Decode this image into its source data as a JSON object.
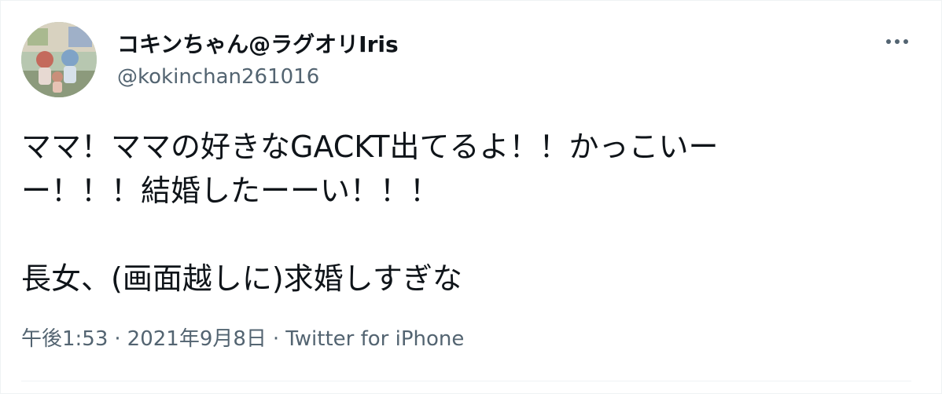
{
  "tweet": {
    "author": {
      "display_name": "コキンちゃん@ラグオリIris",
      "handle": "@kokinchan261016"
    },
    "text": "ママ！ママの好きなGACKT出てるよ！！かっこいー\nー！！！結婚したーーい！！！\n\n長女、(画面越しに)求婚しすぎな",
    "meta": {
      "time": "午後1:53",
      "separator": "·",
      "date": "2021年9月8日",
      "source": "Twitter for iPhone"
    },
    "more_icon": "more-horizontal-icon"
  },
  "colors": {
    "text_primary": "#0f1419",
    "text_secondary": "#536471",
    "divider": "#eff3f4"
  }
}
